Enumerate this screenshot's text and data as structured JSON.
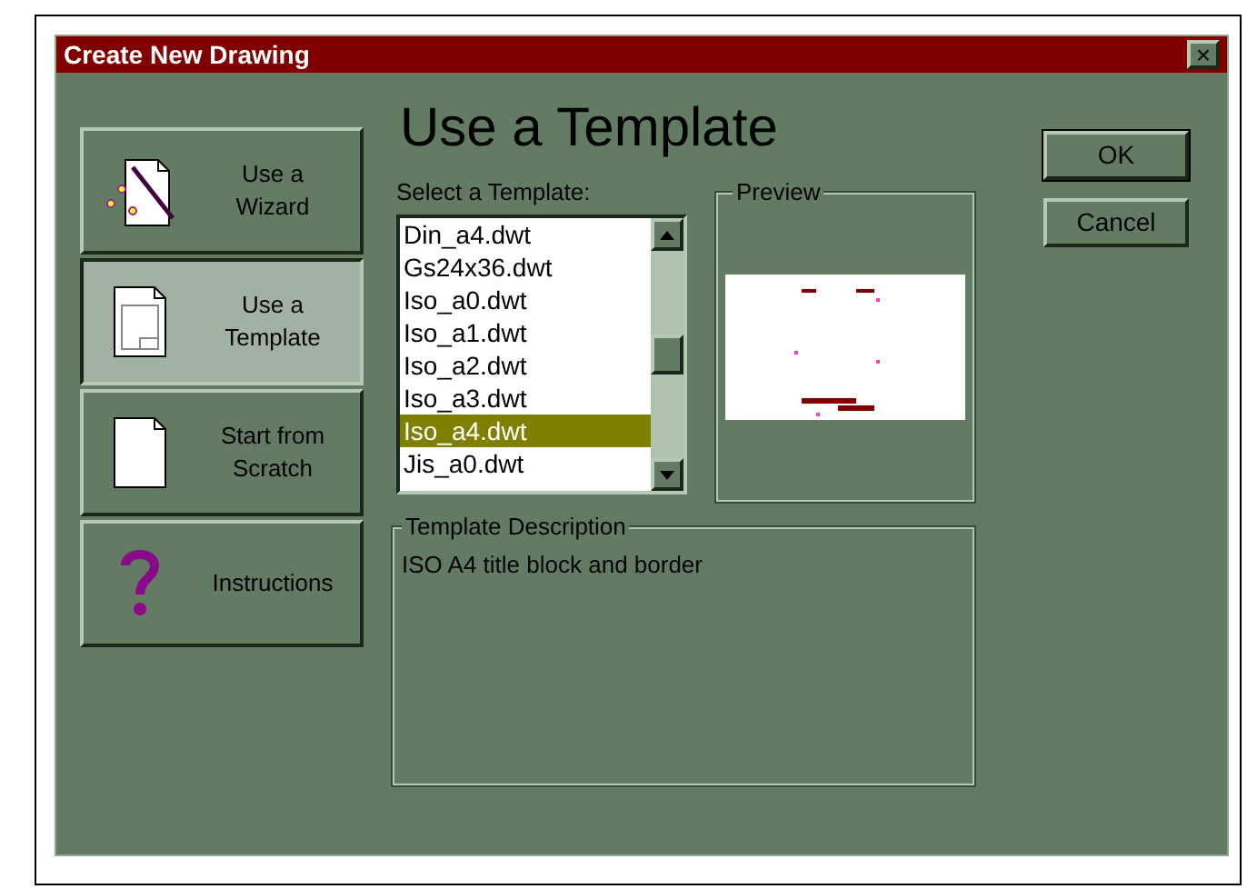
{
  "window": {
    "title": "Create New Drawing",
    "close": "×"
  },
  "modes": [
    {
      "label": "Use a Wizard",
      "kind": "wizard",
      "selected": false
    },
    {
      "label": "Use a Template",
      "kind": "template",
      "selected": true
    },
    {
      "label": "Start from Scratch",
      "kind": "scratch",
      "selected": false
    },
    {
      "label": "Instructions",
      "kind": "help",
      "selected": false
    }
  ],
  "heading": "Use a Template",
  "list_label": "Select a Template:",
  "templates": [
    {
      "name": "Din_a4.dwt",
      "selected": false
    },
    {
      "name": "Gs24x36.dwt",
      "selected": false
    },
    {
      "name": "Iso_a0.dwt",
      "selected": false
    },
    {
      "name": "Iso_a1.dwt",
      "selected": false
    },
    {
      "name": "Iso_a2.dwt",
      "selected": false
    },
    {
      "name": "Iso_a3.dwt",
      "selected": false
    },
    {
      "name": "Iso_a4.dwt",
      "selected": true
    },
    {
      "name": "Jis_a0.dwt",
      "selected": false
    }
  ],
  "preview": {
    "title": "Preview"
  },
  "description": {
    "title": "Template Description",
    "text": "ISO A4 title block and border"
  },
  "buttons": [
    "OK",
    "Cancel"
  ]
}
